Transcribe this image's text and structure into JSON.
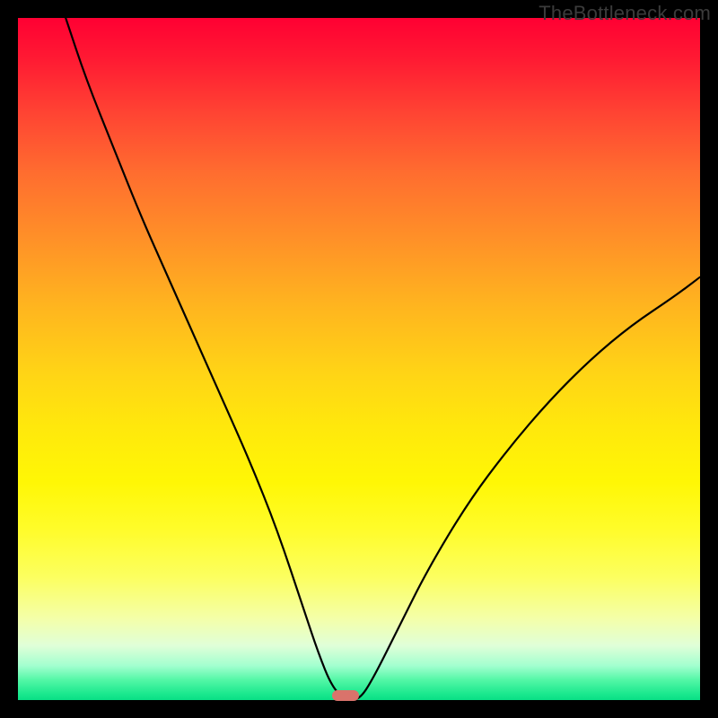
{
  "watermark": {
    "text": "TheBottleneck.com"
  },
  "marker": {
    "x_pct": 48,
    "y_pct": 99.4,
    "color": "#d9736b"
  },
  "chart_data": {
    "type": "line",
    "title": "",
    "xlabel": "",
    "ylabel": "",
    "xlim": [
      0,
      100
    ],
    "ylim": [
      0,
      100
    ],
    "grid": false,
    "legend": false,
    "notes": "Bottleneck-style V curve. Y is mismatch/bottleneck severity (100 = top of gradient / worst, 0 = bottom / optimal). Minimum of the curve sits near x≈48.",
    "series": [
      {
        "name": "bottleneck-curve",
        "x": [
          7,
          10,
          14,
          18,
          22,
          26,
          30,
          34,
          38,
          42,
          44,
          46,
          48,
          50,
          52,
          56,
          60,
          66,
          72,
          78,
          84,
          90,
          96,
          100
        ],
        "y": [
          100,
          91,
          81,
          71,
          62,
          53,
          44,
          35,
          25,
          13,
          7,
          2,
          0,
          0,
          3,
          11,
          19,
          29,
          37,
          44,
          50,
          55,
          59,
          62
        ]
      }
    ],
    "annotation": {
      "optimal_x": 48,
      "optimal_y": 0
    }
  }
}
